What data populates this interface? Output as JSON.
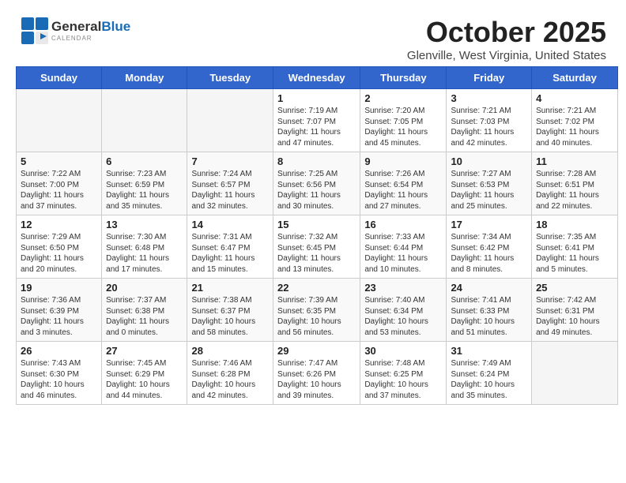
{
  "header": {
    "logo_general": "General",
    "logo_blue": "Blue",
    "month_title": "October 2025",
    "location": "Glenville, West Virginia, United States"
  },
  "days_of_week": [
    "Sunday",
    "Monday",
    "Tuesday",
    "Wednesday",
    "Thursday",
    "Friday",
    "Saturday"
  ],
  "weeks": [
    [
      {
        "day": "",
        "content": ""
      },
      {
        "day": "",
        "content": ""
      },
      {
        "day": "",
        "content": ""
      },
      {
        "day": "1",
        "content": "Sunrise: 7:19 AM\nSunset: 7:07 PM\nDaylight: 11 hours\nand 47 minutes."
      },
      {
        "day": "2",
        "content": "Sunrise: 7:20 AM\nSunset: 7:05 PM\nDaylight: 11 hours\nand 45 minutes."
      },
      {
        "day": "3",
        "content": "Sunrise: 7:21 AM\nSunset: 7:03 PM\nDaylight: 11 hours\nand 42 minutes."
      },
      {
        "day": "4",
        "content": "Sunrise: 7:21 AM\nSunset: 7:02 PM\nDaylight: 11 hours\nand 40 minutes."
      }
    ],
    [
      {
        "day": "5",
        "content": "Sunrise: 7:22 AM\nSunset: 7:00 PM\nDaylight: 11 hours\nand 37 minutes."
      },
      {
        "day": "6",
        "content": "Sunrise: 7:23 AM\nSunset: 6:59 PM\nDaylight: 11 hours\nand 35 minutes."
      },
      {
        "day": "7",
        "content": "Sunrise: 7:24 AM\nSunset: 6:57 PM\nDaylight: 11 hours\nand 32 minutes."
      },
      {
        "day": "8",
        "content": "Sunrise: 7:25 AM\nSunset: 6:56 PM\nDaylight: 11 hours\nand 30 minutes."
      },
      {
        "day": "9",
        "content": "Sunrise: 7:26 AM\nSunset: 6:54 PM\nDaylight: 11 hours\nand 27 minutes."
      },
      {
        "day": "10",
        "content": "Sunrise: 7:27 AM\nSunset: 6:53 PM\nDaylight: 11 hours\nand 25 minutes."
      },
      {
        "day": "11",
        "content": "Sunrise: 7:28 AM\nSunset: 6:51 PM\nDaylight: 11 hours\nand 22 minutes."
      }
    ],
    [
      {
        "day": "12",
        "content": "Sunrise: 7:29 AM\nSunset: 6:50 PM\nDaylight: 11 hours\nand 20 minutes."
      },
      {
        "day": "13",
        "content": "Sunrise: 7:30 AM\nSunset: 6:48 PM\nDaylight: 11 hours\nand 17 minutes."
      },
      {
        "day": "14",
        "content": "Sunrise: 7:31 AM\nSunset: 6:47 PM\nDaylight: 11 hours\nand 15 minutes."
      },
      {
        "day": "15",
        "content": "Sunrise: 7:32 AM\nSunset: 6:45 PM\nDaylight: 11 hours\nand 13 minutes."
      },
      {
        "day": "16",
        "content": "Sunrise: 7:33 AM\nSunset: 6:44 PM\nDaylight: 11 hours\nand 10 minutes."
      },
      {
        "day": "17",
        "content": "Sunrise: 7:34 AM\nSunset: 6:42 PM\nDaylight: 11 hours\nand 8 minutes."
      },
      {
        "day": "18",
        "content": "Sunrise: 7:35 AM\nSunset: 6:41 PM\nDaylight: 11 hours\nand 5 minutes."
      }
    ],
    [
      {
        "day": "19",
        "content": "Sunrise: 7:36 AM\nSunset: 6:39 PM\nDaylight: 11 hours\nand 3 minutes."
      },
      {
        "day": "20",
        "content": "Sunrise: 7:37 AM\nSunset: 6:38 PM\nDaylight: 11 hours\nand 0 minutes."
      },
      {
        "day": "21",
        "content": "Sunrise: 7:38 AM\nSunset: 6:37 PM\nDaylight: 10 hours\nand 58 minutes."
      },
      {
        "day": "22",
        "content": "Sunrise: 7:39 AM\nSunset: 6:35 PM\nDaylight: 10 hours\nand 56 minutes."
      },
      {
        "day": "23",
        "content": "Sunrise: 7:40 AM\nSunset: 6:34 PM\nDaylight: 10 hours\nand 53 minutes."
      },
      {
        "day": "24",
        "content": "Sunrise: 7:41 AM\nSunset: 6:33 PM\nDaylight: 10 hours\nand 51 minutes."
      },
      {
        "day": "25",
        "content": "Sunrise: 7:42 AM\nSunset: 6:31 PM\nDaylight: 10 hours\nand 49 minutes."
      }
    ],
    [
      {
        "day": "26",
        "content": "Sunrise: 7:43 AM\nSunset: 6:30 PM\nDaylight: 10 hours\nand 46 minutes."
      },
      {
        "day": "27",
        "content": "Sunrise: 7:45 AM\nSunset: 6:29 PM\nDaylight: 10 hours\nand 44 minutes."
      },
      {
        "day": "28",
        "content": "Sunrise: 7:46 AM\nSunset: 6:28 PM\nDaylight: 10 hours\nand 42 minutes."
      },
      {
        "day": "29",
        "content": "Sunrise: 7:47 AM\nSunset: 6:26 PM\nDaylight: 10 hours\nand 39 minutes."
      },
      {
        "day": "30",
        "content": "Sunrise: 7:48 AM\nSunset: 6:25 PM\nDaylight: 10 hours\nand 37 minutes."
      },
      {
        "day": "31",
        "content": "Sunrise: 7:49 AM\nSunset: 6:24 PM\nDaylight: 10 hours\nand 35 minutes."
      },
      {
        "day": "",
        "content": ""
      }
    ]
  ]
}
